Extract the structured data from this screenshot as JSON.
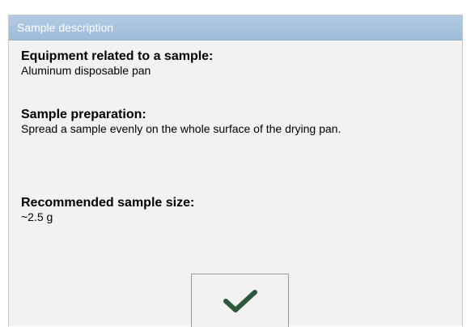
{
  "window": {
    "title": "Sample description"
  },
  "sections": {
    "equipment": {
      "label": "Equipment related to a sample:",
      "value": "Aluminum disposable pan"
    },
    "preparation": {
      "label": "Sample preparation:",
      "value": "Spread a sample evenly on the whole surface of the drying pan."
    },
    "size": {
      "label": "Recommended sample size:",
      "value": "~2.5 g"
    }
  },
  "buttons": {
    "confirm": {
      "icon": "checkmark-icon",
      "icon_color": "#2d5a3d"
    }
  },
  "colors": {
    "title_bar": "#a9c4df",
    "background": "#f2f2f2"
  }
}
